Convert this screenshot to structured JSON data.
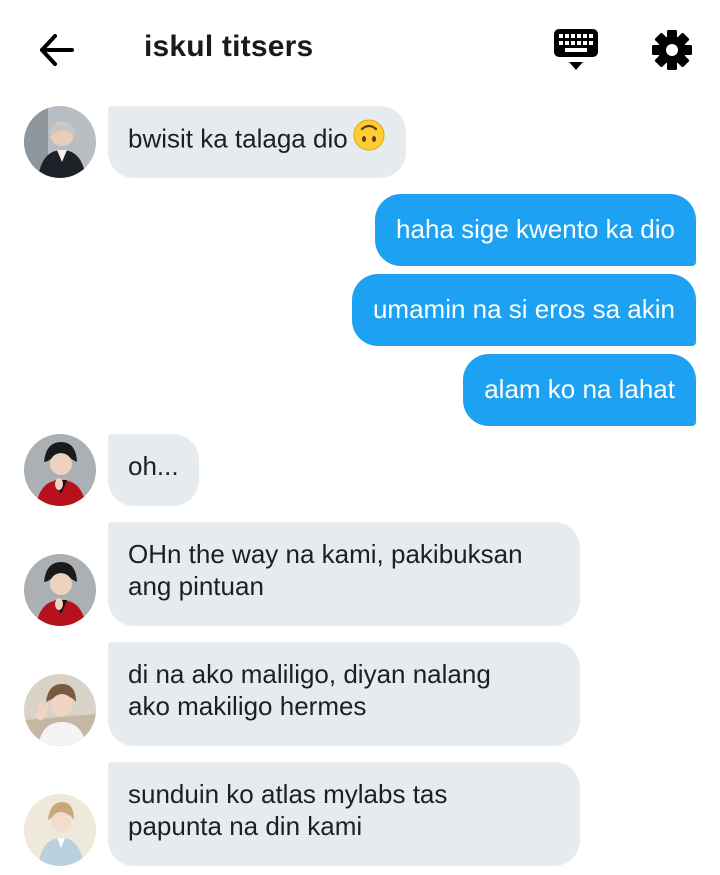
{
  "header": {
    "title": "iskul titsers",
    "back_icon": "arrow-left-icon",
    "keyboard_icon": "keyboard-icon",
    "settings_icon": "gear-icon"
  },
  "messages": [
    {
      "direction": "incoming",
      "text": "bwisit ka talaga dio",
      "emoji": "upside-down-face-icon"
    },
    {
      "direction": "outgoing",
      "text": "haha sige kwento ka dio"
    },
    {
      "direction": "outgoing",
      "text": "umamin na si eros sa akin"
    },
    {
      "direction": "outgoing",
      "text": "alam ko na lahat"
    },
    {
      "direction": "incoming",
      "text": "oh..."
    },
    {
      "direction": "incoming",
      "text": "OHn the way na kami, pakibuksan\nang pintuan"
    },
    {
      "direction": "incoming",
      "text": "di na ako maliligo, diyan nalang\nako makiligo hermes"
    },
    {
      "direction": "incoming",
      "text": "sunduin ko atlas mylabs tas\npapunta na din kami"
    }
  ],
  "colors": {
    "incoming_bubble": "#e6ebf0",
    "outgoing_bubble": "#1da1f2",
    "outgoing_text": "#ffffff",
    "icon": "#000000"
  }
}
